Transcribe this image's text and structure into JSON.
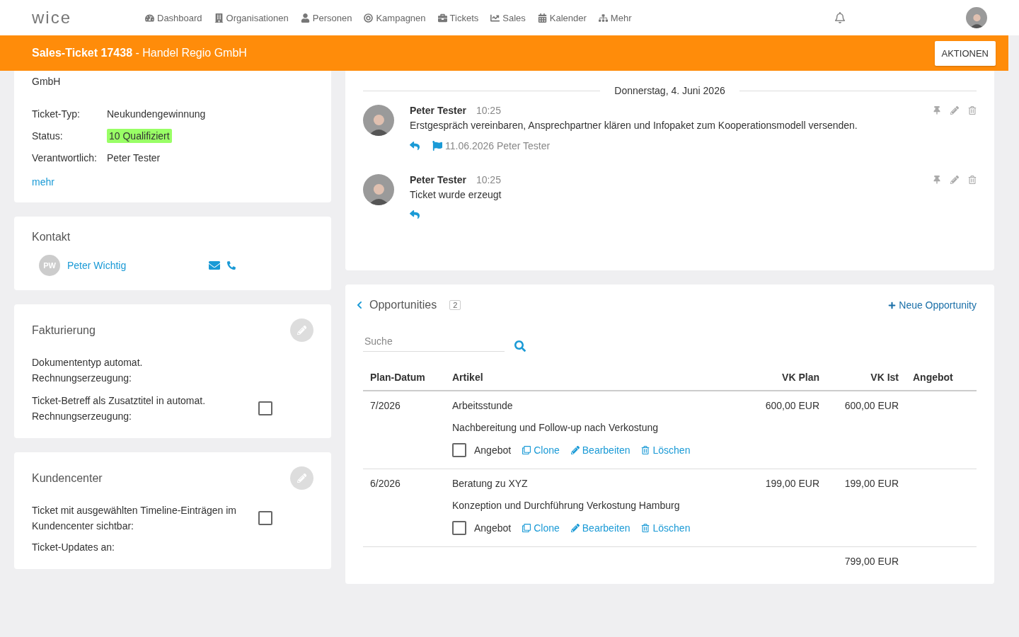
{
  "nav": {
    "logo": "wice",
    "items": [
      {
        "label": "Dashboard"
      },
      {
        "label": "Organisationen"
      },
      {
        "label": "Personen"
      },
      {
        "label": "Kampagnen"
      },
      {
        "label": "Tickets"
      },
      {
        "label": "Sales"
      },
      {
        "label": "Kalender"
      },
      {
        "label": "Mehr"
      }
    ]
  },
  "header": {
    "title": "Sales-Ticket 17438",
    "subtitle": " - Handel Regio GmbH",
    "action": "AKTIONEN"
  },
  "ticket_card": {
    "subject": "GmbH",
    "fields": [
      {
        "label": "Ticket-Typ:",
        "value": "Neukundengewinnung",
        "kind": "text"
      },
      {
        "label": "Status:",
        "value": "10 Qualifiziert",
        "kind": "badge",
        "color": "#99ff66"
      },
      {
        "label": "Verantwortlich:",
        "value": "Peter Tester",
        "kind": "text"
      }
    ],
    "more": "mehr"
  },
  "contact": {
    "title": "Kontakt",
    "initials": "PW",
    "name": "Peter Wichtig"
  },
  "billing": {
    "title": "Fakturierung",
    "rows": [
      {
        "label": "Dokumententyp automat. Rechnungserzeugung:",
        "kind": "text"
      },
      {
        "label": "Ticket-Betreff als Zusatztitel in automat. Rechnungserzeugung:",
        "kind": "checkbox",
        "checked": false
      }
    ]
  },
  "customer_center": {
    "title": "Kundencenter",
    "rows": [
      {
        "label": "Ticket mit ausgewählten Timeline-Einträgen im Kundencenter sichtbar:",
        "kind": "checkbox",
        "checked": false
      },
      {
        "label": "Ticket-Updates an:",
        "kind": "text"
      }
    ]
  },
  "timeline": {
    "date": "Donnerstag, 4. Juni 2026",
    "entries": [
      {
        "author": "Peter Tester",
        "time": "10:25",
        "text": "Erstgespräch vereinbaren, Ansprechpartner klären und Infopaket zum Kooperationsmodell versenden.",
        "flag": "11.06.2026 Peter Tester"
      },
      {
        "author": "Peter Tester",
        "time": "10:25",
        "text": "Ticket wurde erzeugt"
      }
    ]
  },
  "opportunities": {
    "title": "Opportunities",
    "count": "2",
    "new_link": "Neue Opportunity",
    "search": {
      "placeholder": "Suche"
    },
    "columns": [
      "Plan-Datum",
      "Artikel",
      "VK Plan",
      "VK Ist",
      "Angebot"
    ],
    "rows": [
      {
        "date": "7/2026",
        "article": "Arbeitsstunde",
        "description": "Nachbereitung und Follow-up nach Verkostung",
        "vk_plan": "600,00 EUR",
        "vk_ist": "600,00 EUR",
        "offer": "Angebot",
        "offer_checked": false,
        "actions": [
          "Clone",
          "Bearbeiten",
          "Löschen"
        ]
      },
      {
        "date": "6/2026",
        "article": "Beratung zu XYZ",
        "description": "Konzeption und Durchführung Verkostung Hamburg",
        "vk_plan": "199,00 EUR",
        "vk_ist": "199,00 EUR",
        "offer": "Angebot",
        "offer_checked": false,
        "actions": [
          "Clone",
          "Bearbeiten",
          "Löschen"
        ]
      }
    ],
    "total": "799,00 EUR"
  }
}
